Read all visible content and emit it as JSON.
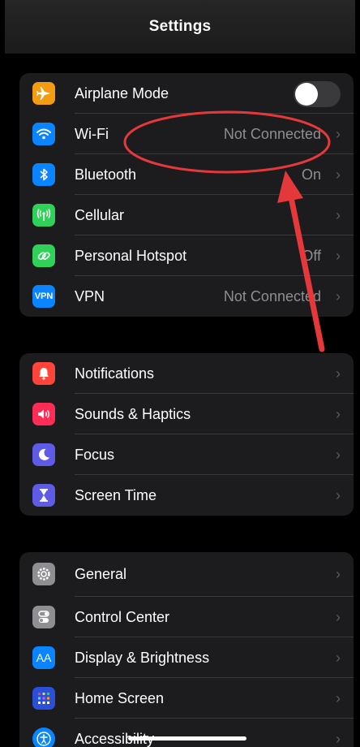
{
  "nav": {
    "title": "Settings"
  },
  "colors": {
    "airplane": "#f39c12",
    "wifi": "#0a84ff",
    "bluetooth": "#0a84ff",
    "cellular": "#30d158",
    "hotspot": "#30d158",
    "vpn": "#0a84ff",
    "notifications": "#ff453a",
    "sounds": "#ff2d55",
    "focus": "#5e5ce6",
    "screen_time": "#5e5ce6",
    "general": "#8e8e93",
    "control_center": "#8e8e93",
    "display": "#0a84ff",
    "home_screen": "#2c4fd8",
    "accessibility": "#0a84ff",
    "annotation": "#e5383b"
  },
  "group1": {
    "airplane": {
      "label": "Airplane Mode",
      "icon": "airplane-icon",
      "toggle_on": false
    },
    "wifi": {
      "label": "Wi-Fi",
      "value": "Not Connected",
      "icon": "wifi-icon"
    },
    "bluetooth": {
      "label": "Bluetooth",
      "value": "On",
      "icon": "bluetooth-icon"
    },
    "cellular": {
      "label": "Cellular",
      "icon": "antenna-icon"
    },
    "hotspot": {
      "label": "Personal Hotspot",
      "value": "Off",
      "icon": "link-chain-icon"
    },
    "vpn": {
      "label": "VPN",
      "value": "Not Connected",
      "icon_text": "VPN"
    }
  },
  "group2": {
    "notifications": {
      "label": "Notifications",
      "icon": "bell-icon"
    },
    "sounds": {
      "label": "Sounds & Haptics",
      "icon": "speaker-icon"
    },
    "focus": {
      "label": "Focus",
      "icon": "moon-icon"
    },
    "screen_time": {
      "label": "Screen Time",
      "icon": "hourglass-icon"
    }
  },
  "group3": {
    "general": {
      "label": "General",
      "icon": "gear-icon"
    },
    "control_center": {
      "label": "Control Center",
      "icon": "switches-icon"
    },
    "display": {
      "label": "Display & Brightness",
      "icon_text": "AA"
    },
    "home_screen": {
      "label": "Home Screen",
      "icon": "app-grid-icon"
    },
    "accessibility": {
      "label": "Accessibility",
      "icon": "accessibility-icon"
    }
  },
  "chevron": "›"
}
